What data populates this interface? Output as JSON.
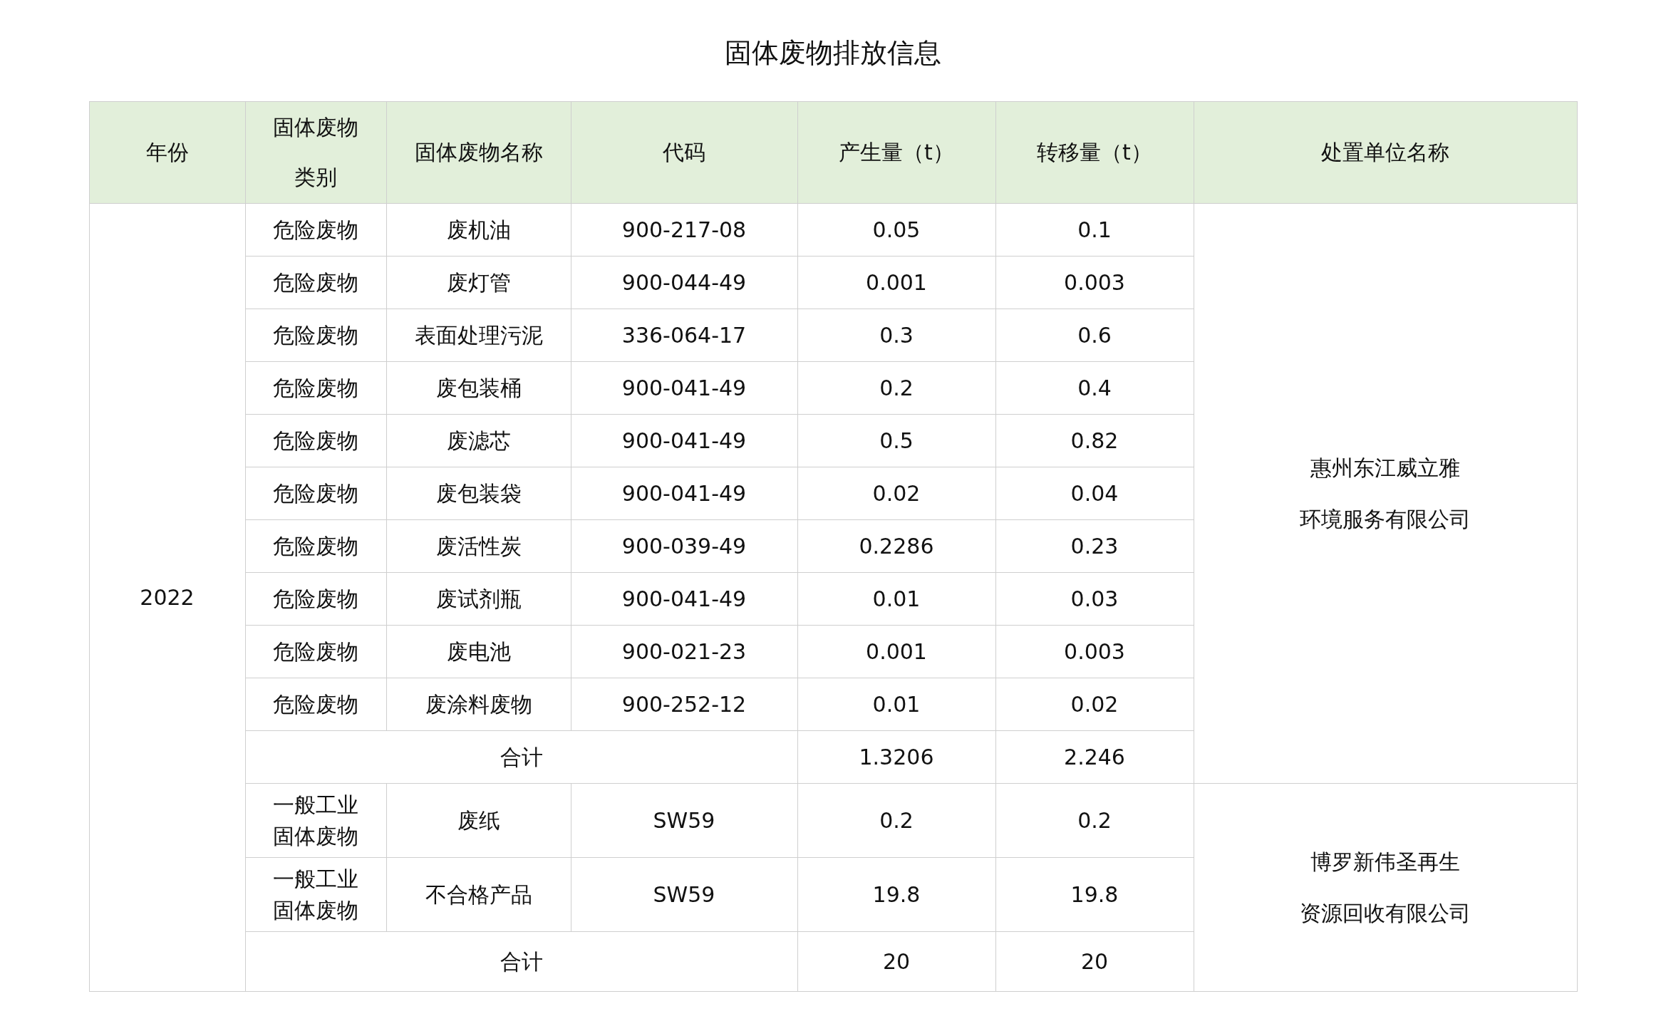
{
  "title": "固体废物排放信息",
  "columns": [
    {
      "lines": [
        "年份"
      ]
    },
    {
      "lines": [
        "固体废物",
        "类别"
      ]
    },
    {
      "lines": [
        "固体废物名称"
      ]
    },
    {
      "lines": [
        "代码"
      ]
    },
    {
      "lines": [
        "产生量（t）"
      ]
    },
    {
      "lines": [
        "转移量（t）"
      ]
    },
    {
      "lines": [
        "处置单位名称"
      ]
    }
  ],
  "year": "2022",
  "groups": [
    {
      "disposer": [
        "惠州东江威立雅",
        "环境服务有限公司"
      ],
      "total": {
        "label": "合计",
        "produced": "1.3206",
        "transferred": "2.246"
      },
      "rows": [
        {
          "category": [
            "危险废物"
          ],
          "name": "废机油",
          "code": "900-217-08",
          "produced": "0.05",
          "transferred": "0.1"
        },
        {
          "category": [
            "危险废物"
          ],
          "name": "废灯管",
          "code": "900-044-49",
          "produced": "0.001",
          "transferred": "0.003"
        },
        {
          "category": [
            "危险废物"
          ],
          "name": "表面处理污泥",
          "code": "336-064-17",
          "produced": "0.3",
          "transferred": "0.6"
        },
        {
          "category": [
            "危险废物"
          ],
          "name": "废包装桶",
          "code": "900-041-49",
          "produced": "0.2",
          "transferred": "0.4"
        },
        {
          "category": [
            "危险废物"
          ],
          "name": "废滤芯",
          "code": "900-041-49",
          "produced": "0.5",
          "transferred": "0.82"
        },
        {
          "category": [
            "危险废物"
          ],
          "name": "废包装袋",
          "code": "900-041-49",
          "produced": "0.02",
          "transferred": "0.04"
        },
        {
          "category": [
            "危险废物"
          ],
          "name": "废活性炭",
          "code": "900-039-49",
          "produced": "0.2286",
          "transferred": "0.23"
        },
        {
          "category": [
            "危险废物"
          ],
          "name": "废试剂瓶",
          "code": "900-041-49",
          "produced": "0.01",
          "transferred": "0.03"
        },
        {
          "category": [
            "危险废物"
          ],
          "name": "废电池",
          "code": "900-021-23",
          "produced": "0.001",
          "transferred": "0.003"
        },
        {
          "category": [
            "危险废物"
          ],
          "name": "废涂料废物",
          "code": "900-252-12",
          "produced": "0.01",
          "transferred": "0.02"
        }
      ]
    },
    {
      "disposer": [
        "博罗新伟圣再生",
        "资源回收有限公司"
      ],
      "total": {
        "label": "合计",
        "produced": "20",
        "transferred": "20"
      },
      "rows": [
        {
          "category": [
            "一般工业",
            "固体废物"
          ],
          "name": "废纸",
          "code": "SW59",
          "produced": "0.2",
          "transferred": "0.2"
        },
        {
          "category": [
            "一般工业",
            "固体废物"
          ],
          "name": "不合格产品",
          "code": "SW59",
          "produced": "19.8",
          "transferred": "19.8"
        }
      ]
    }
  ]
}
